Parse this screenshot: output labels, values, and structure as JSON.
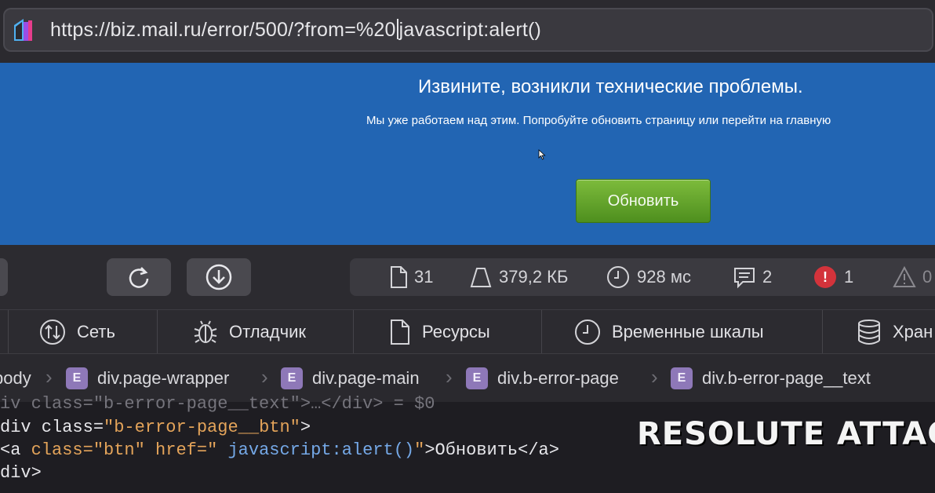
{
  "browser": {
    "url_before_caret": "https://biz.mail.ru/error/500/?from=%20",
    "url_after_caret": "javascript:alert()"
  },
  "page": {
    "title": "Извините, возникли технические проблемы.",
    "subtitle": "Мы уже работаем над этим. Попробуйте обновить страницу или перейти на главную",
    "refresh_button": "Обновить",
    "accent_color": "#2265b3",
    "button_color": "#5fa22c"
  },
  "devtools": {
    "stats": {
      "resources": "31",
      "size": "379,2 КБ",
      "time": "928 мс",
      "logs": "2",
      "errors": "1",
      "errors_icon": "!",
      "warnings": "0"
    },
    "tabs": [
      {
        "label": "Сеть",
        "icon": "network-icon"
      },
      {
        "label": "Отладчик",
        "icon": "bug-icon"
      },
      {
        "label": "Ресурсы",
        "icon": "document-icon"
      },
      {
        "label": "Временные шкалы",
        "icon": "clock-icon"
      },
      {
        "label": "Хран",
        "icon": "database-icon"
      }
    ],
    "breadcrumb": {
      "badge": "E",
      "items": [
        "body",
        "div.page-wrapper",
        "div.page-main",
        "div.b-error-page",
        "div.b-error-page__text"
      ]
    },
    "code": {
      "line1": "iv class=\"b-error-page__text\">…</div> = $0",
      "line2_open": "div class=",
      "line2_val": "\"b-error-page__btn\"",
      "line2_close": ">",
      "line3_a": "<a ",
      "line3_class": "class=",
      "line3_classval": "\"btn\"",
      "line3_href": " href=",
      "line3_q1": "\" ",
      "line3_js": "javascript:alert()",
      "line3_q2": "\"",
      "line3_text": ">Обновить</a>",
      "line4": "div>"
    }
  },
  "watermark": "RESOLUTE ATTACK"
}
